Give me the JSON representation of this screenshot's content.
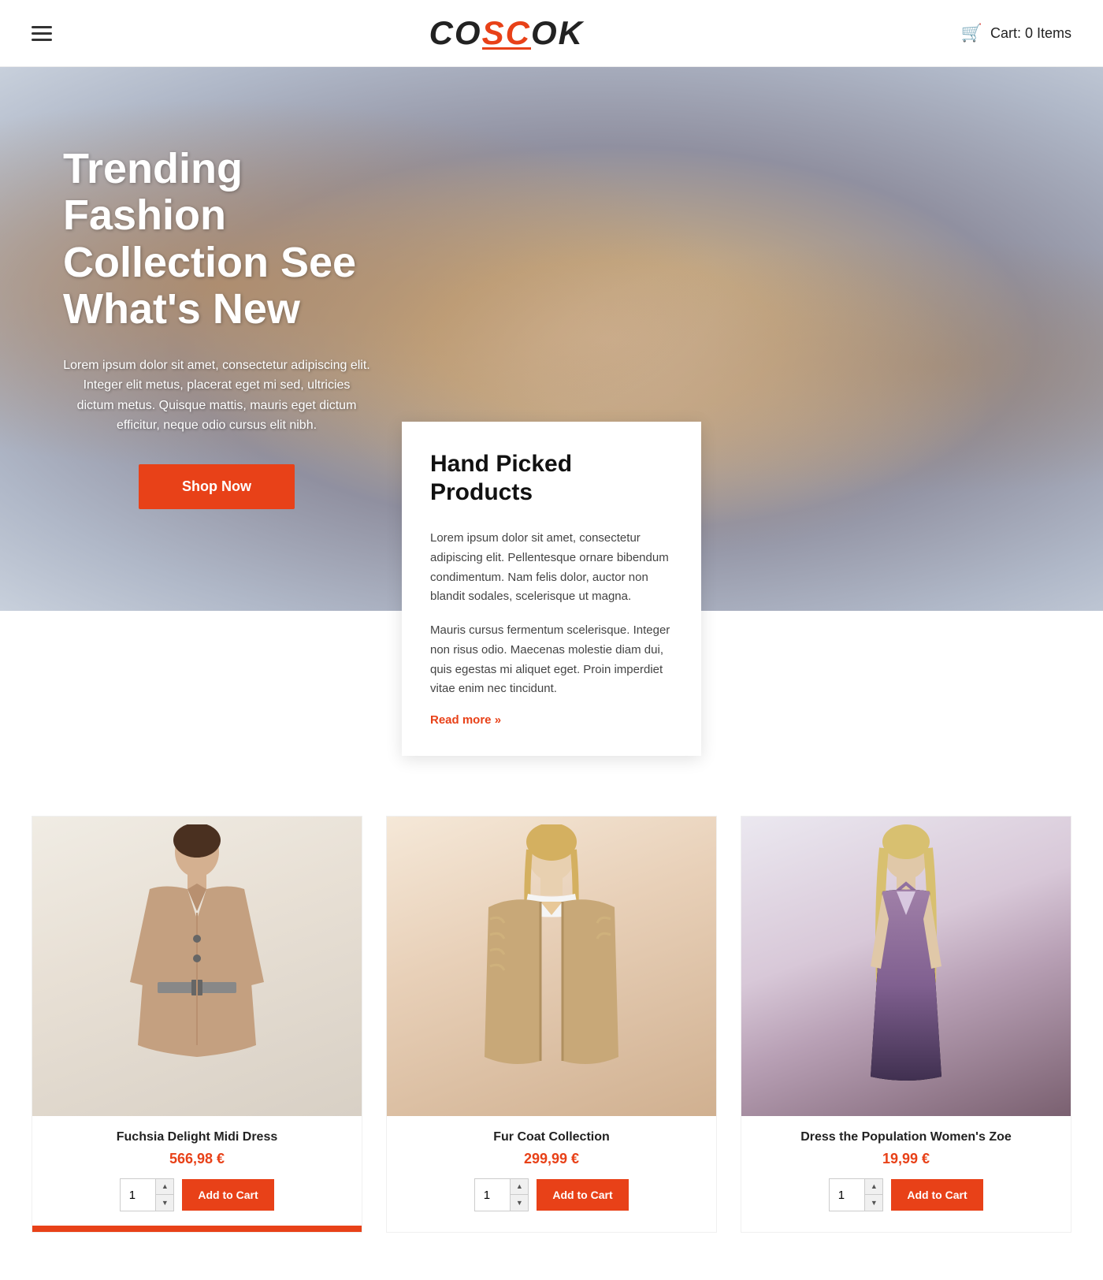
{
  "header": {
    "logo_prefix": "COS",
    "logo_highlight": "C",
    "logo_suffix": "OK",
    "logo_full": "COSCOK",
    "cart_label": "Cart: 0 Items"
  },
  "hero": {
    "title": "Trending Fashion Collection See What's New",
    "description": "Lorem ipsum dolor sit amet, consectetur adipiscing elit. Integer elit metus, placerat eget mi sed, ultricies dictum metus. Quisque mattis, mauris eget dictum efficitur, neque odio cursus elit nibh.",
    "cta_label": "Shop Now"
  },
  "handpicked": {
    "title": "Hand Picked\nProducts",
    "title_line1": "Hand Picked",
    "title_line2": "Products",
    "para1": "Lorem ipsum dolor sit amet, consectetur adipiscing elit. Pellentesque ornare bibendum condimentum. Nam felis dolor, auctor non blandit sodales, scelerisque ut magna.",
    "para2": "Mauris cursus fermentum scelerisque. Integer non risus odio. Maecenas molestie diam dui, quis egestas mi aliquet eget. Proin imperdiet vitae enim nec tincidunt.",
    "read_more": "Read more »"
  },
  "products": [
    {
      "name": "Fuchsia Delight Midi Dress",
      "price": "566,98 €",
      "qty": "1",
      "add_to_cart": "Add to Cart",
      "type": "coat"
    },
    {
      "name": "Fur Coat Collection",
      "price": "299,99 €",
      "qty": "1",
      "add_to_cart": "Add to Cart",
      "type": "fur"
    },
    {
      "name": "Dress the Population Women's Zoe",
      "price": "19,99 €",
      "qty": "1",
      "add_to_cart": "Add to Cart",
      "type": "dress"
    }
  ],
  "icons": {
    "hamburger": "☰",
    "cart": "🛍"
  }
}
